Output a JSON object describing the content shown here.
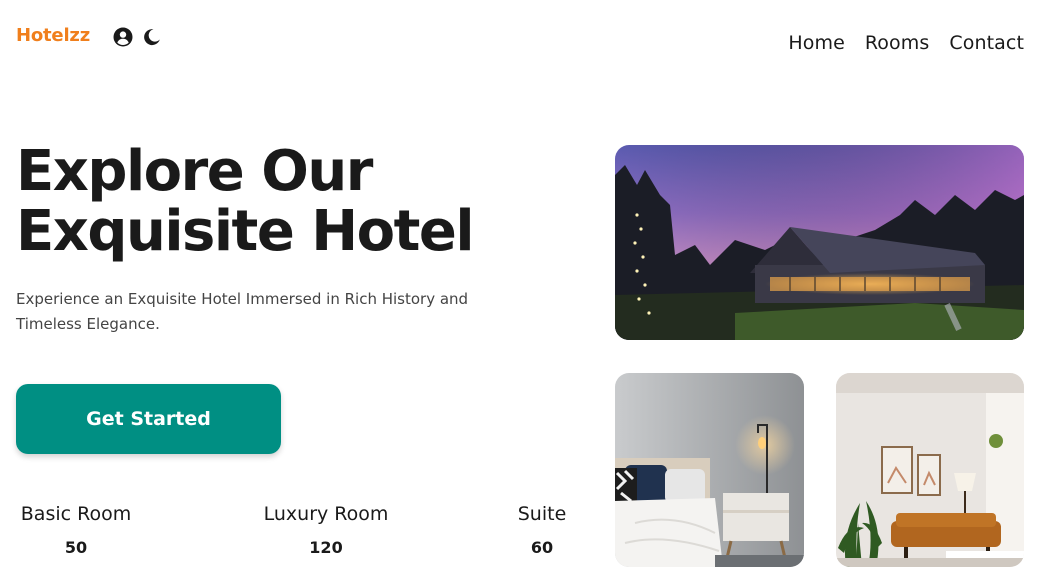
{
  "header": {
    "logo": "Hotelzz",
    "icons": [
      "user-circle-icon",
      "moon-icon"
    ],
    "nav": [
      {
        "label": "Home"
      },
      {
        "label": "Rooms"
      },
      {
        "label": "Contact"
      }
    ]
  },
  "hero": {
    "title_line1": "Explore Our",
    "title_line2": "Exquisite Hotel",
    "subtitle": "Experience an Exquisite Hotel Immersed in Rich History and Timeless Elegance.",
    "cta_label": "Get Started"
  },
  "stats": [
    {
      "label": "Basic Room",
      "value": "50"
    },
    {
      "label": "Luxury Room",
      "value": "120"
    },
    {
      "label": "Suite",
      "value": "60"
    }
  ],
  "images": [
    {
      "name": "hotel-exterior-photo"
    },
    {
      "name": "bedroom-photo"
    },
    {
      "name": "living-room-photo"
    }
  ],
  "colors": {
    "logo": "#f07f1c",
    "cta_background": "#008f83",
    "text": "#1a1a1a"
  }
}
